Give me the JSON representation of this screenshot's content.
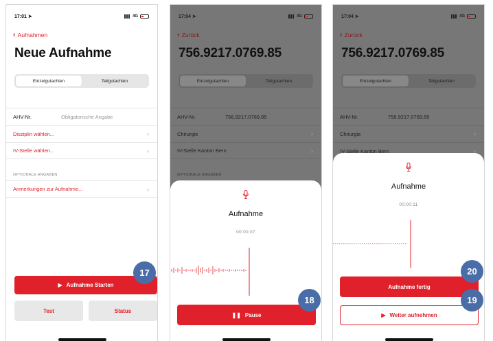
{
  "screens": [
    {
      "status_time": "17:01",
      "status_net": "4G",
      "back_label": "Aufnahmen",
      "title": "Neue Aufnahme",
      "segments": [
        "Einzelgutachten",
        "Teilgutachten"
      ],
      "ahv_label": "AHV-Nr.",
      "ahv_placeholder": "Obligatorische Angabe",
      "discipline": "Disziplin wählen...",
      "iv_office": "IV-Stelle wählen...",
      "optional_header": "OPTIONALE ANGABEN",
      "notes": "Anmerkungen zur Aufnahme...",
      "start_button": "Aufnahme Starten",
      "test_button": "Test",
      "status_button": "Status",
      "badge": "17"
    },
    {
      "status_time": "17:04",
      "status_net": "4G",
      "back_label": "Zurück",
      "title": "756.9217.0769.85",
      "segments": [
        "Einzelgutachten",
        "Teilgutachten"
      ],
      "ahv_label": "AHV-Nr.",
      "ahv_value": "756.9217.0769.85",
      "discipline": "Chirurgie",
      "iv_office": "IV-Stelle Kanton Bern",
      "optional_header": "OPTIONALE ANGABEN",
      "sheet_title": "Aufnahme",
      "timer": "00:00:07",
      "pause_button": "Pause",
      "badge": "18"
    },
    {
      "status_time": "17:04",
      "status_net": "4G",
      "back_label": "Zurück",
      "title": "756.9217.0769.85",
      "segments": [
        "Einzelgutachten",
        "Teilgutachten"
      ],
      "ahv_label": "AHV-Nr.",
      "ahv_value": "756.9217.0769.85",
      "discipline": "Chirurgie",
      "iv_office": "IV-Stelle Kanton Bern",
      "sheet_title": "Aufnahme",
      "timer": "00:00:11",
      "finish_button": "Aufnahme fertig",
      "resume_button": "Weiter aufnehmen",
      "badge_finish": "20",
      "badge_resume": "19"
    }
  ],
  "colors": {
    "accent": "#e0202a",
    "badge": "#4a6da8"
  }
}
